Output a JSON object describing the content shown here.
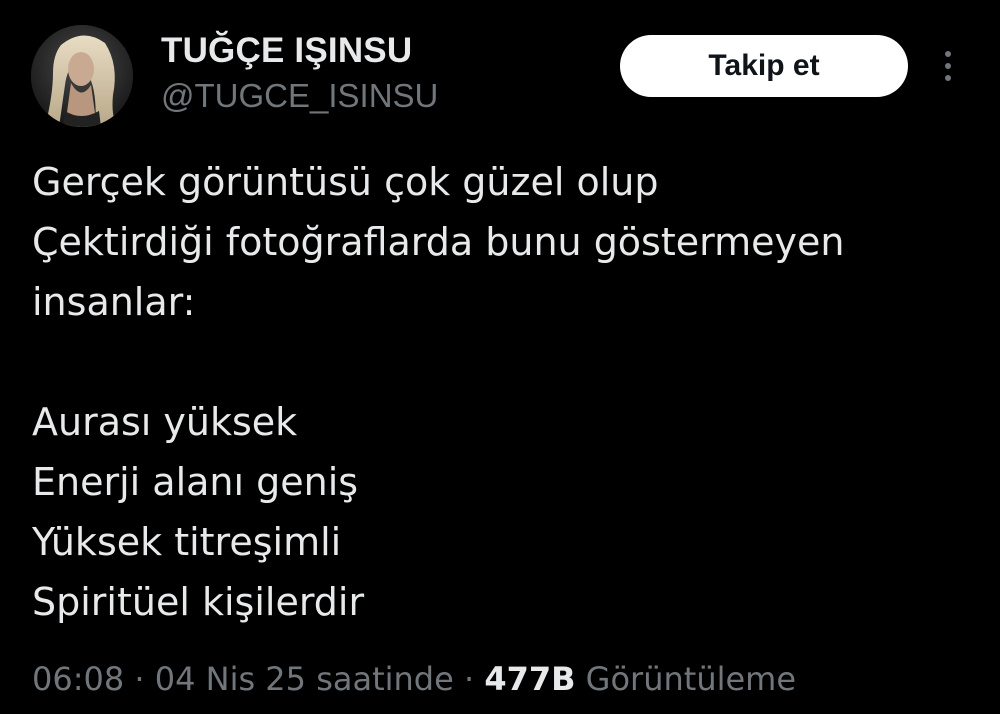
{
  "author": {
    "display_name": "TUĞÇE IŞINSU",
    "handle": "@TUGCE_ISINSU"
  },
  "actions": {
    "follow_label": "Takip et",
    "more_icon": "more-vertical-icon"
  },
  "tweet": {
    "lines": [
      "Gerçek görüntüsü çok güzel olup",
      "Çektirdiği fotoğraflarda bunu göstermeyen",
      "insanlar:",
      "",
      "Aurası yüksek",
      "Enerji alanı geniş",
      "Yüksek titreşimli",
      "Spiritüel kişilerdir"
    ]
  },
  "meta": {
    "time": "06:08",
    "separator_1": " · ",
    "date": "04 Nis 25 saatinde",
    "separator_2": " · ",
    "views_count": "477B",
    "views_label": "Görüntüleme"
  },
  "colors": {
    "background": "#000000",
    "primary_text": "#e7e9ea",
    "secondary_text": "#71767b",
    "button_bg": "#ffffff",
    "button_text": "#0f1419"
  }
}
